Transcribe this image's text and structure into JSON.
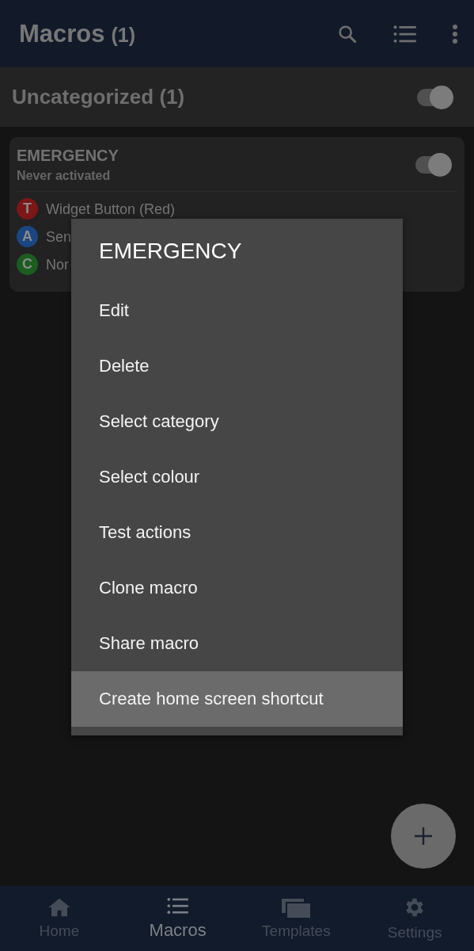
{
  "app_bar": {
    "title": "Macros",
    "count": "(1)"
  },
  "category": {
    "name": "Uncategorized",
    "count": "(1)",
    "on": true
  },
  "macro": {
    "name": "EMERGENCY",
    "status": "Never activated",
    "on": true,
    "items": [
      {
        "badge": "T",
        "text": "Widget Button (Red)",
        "color": "#7d1616"
      },
      {
        "badge": "A",
        "text": "Sen",
        "color": "#1b4680"
      },
      {
        "badge": "C",
        "text": "Nor",
        "color": "#1b5c1f"
      }
    ]
  },
  "menu": {
    "title": "EMERGENCY",
    "items": [
      {
        "label": "Edit",
        "selected": false
      },
      {
        "label": "Delete",
        "selected": false
      },
      {
        "label": "Select category",
        "selected": false
      },
      {
        "label": "Select colour",
        "selected": false
      },
      {
        "label": "Test actions",
        "selected": false
      },
      {
        "label": "Clone macro",
        "selected": false
      },
      {
        "label": "Share macro",
        "selected": false
      },
      {
        "label": "Create home screen shortcut",
        "selected": true
      }
    ]
  },
  "nav": [
    {
      "label": "Home",
      "selected": false
    },
    {
      "label": "Macros",
      "selected": true
    },
    {
      "label": "Templates",
      "selected": false
    },
    {
      "label": "Settings",
      "selected": false
    }
  ]
}
